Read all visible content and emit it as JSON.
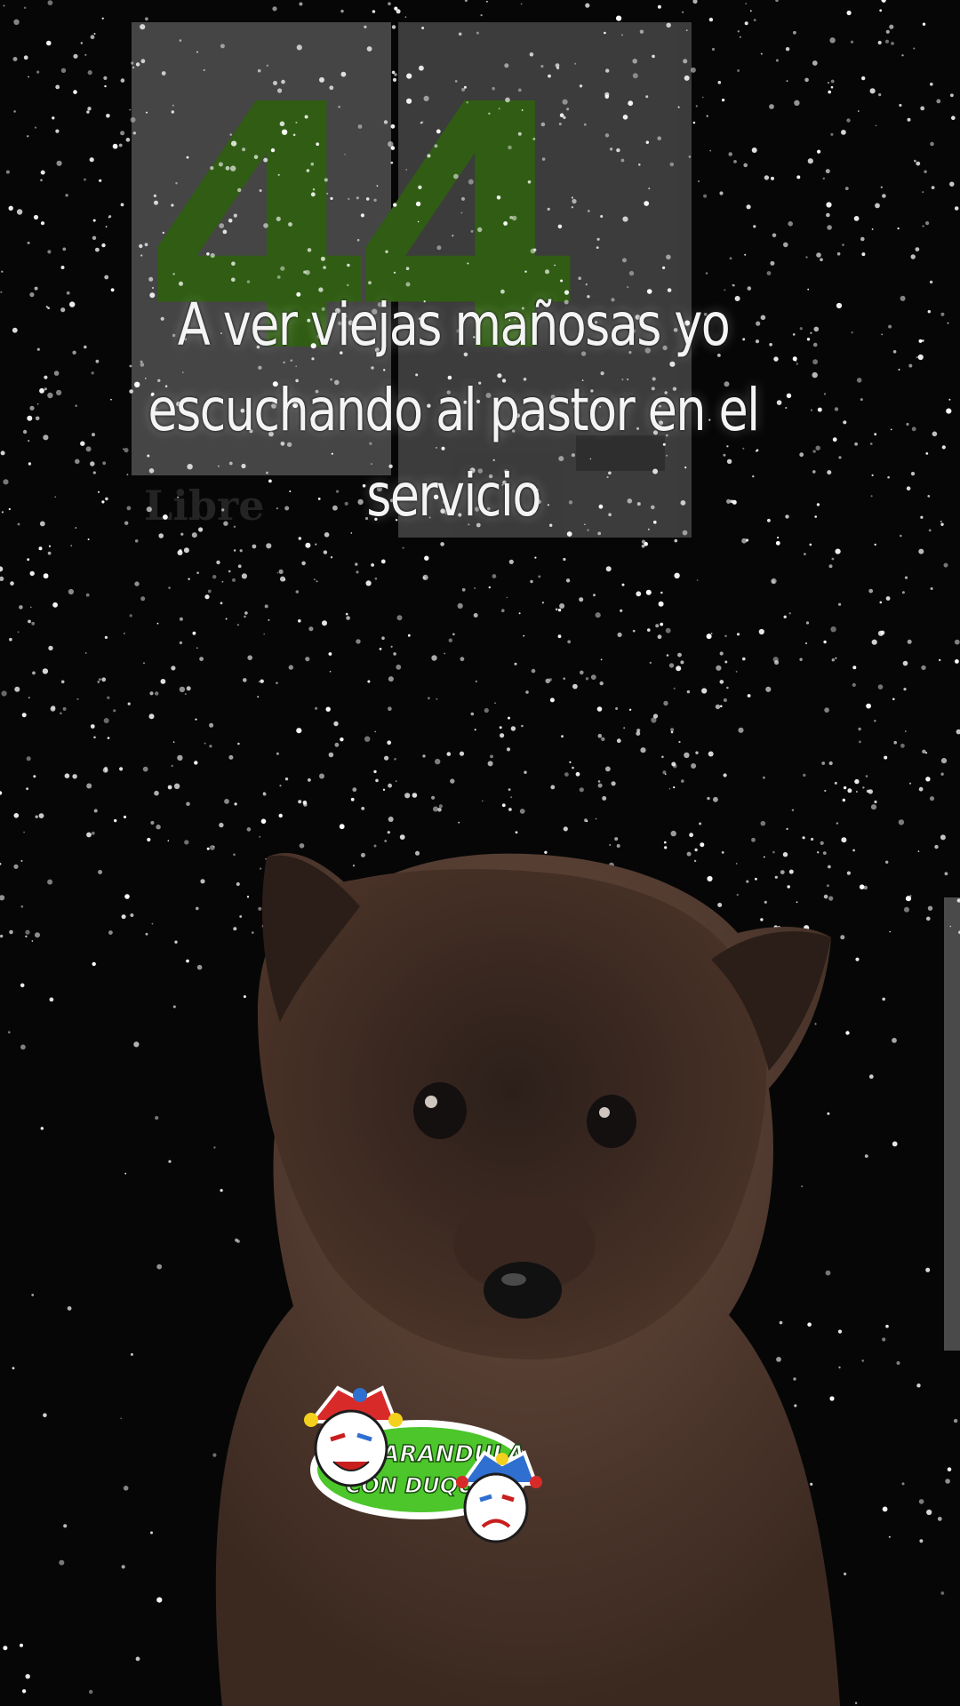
{
  "caption": {
    "line1": "A ver  viejas mañosas yo",
    "line2": "escuchando al pastor en el",
    "line3": "servicio"
  },
  "watermark": {
    "logo_text": "44",
    "subtext": "Libre"
  },
  "sticker": {
    "line1": "LA FARANDULA",
    "line2": "CON DUQUE"
  },
  "colors": {
    "background": "#060606",
    "logo_green": "#3f7a18",
    "sticker_green": "#4cc62a",
    "puppy_fur": "#4a3328",
    "caption_text": "#f4f4f4"
  }
}
